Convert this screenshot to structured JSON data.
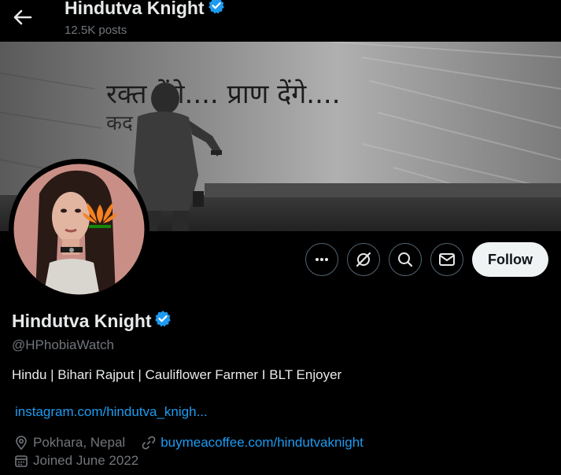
{
  "header": {
    "title": "Hindutva Knight",
    "posts": "12.5K posts",
    "back_icon": "arrow-left-icon",
    "verified_icon": "verified-badge-icon"
  },
  "banner": {
    "wall_text_line1": "रक्त देंगे.... प्राण देंगे....",
    "wall_text_line2": "कद"
  },
  "actions": {
    "more_icon": "more-icon",
    "grok_icon": "grok-icon",
    "search_icon": "search-icon",
    "message_icon": "envelope-icon",
    "follow_label": "Follow"
  },
  "profile": {
    "name": "Hindutva Knight",
    "handle": "@HPhobiaWatch",
    "bio": "Hindu | Bihari Rajput | Cauliflower Farmer I BLT Enjoyer",
    "website": "instagram.com/hindutva_knigh...",
    "location": "Pokhara, Nepal",
    "link": "buymeacoffee.com/hindutvaknight",
    "joined": "Joined June 2022"
  },
  "colors": {
    "background": "#000000",
    "accent": "#1d9bf0",
    "muted": "#71767b",
    "text": "#e7e9ea",
    "follow_bg": "#eff3f4"
  }
}
